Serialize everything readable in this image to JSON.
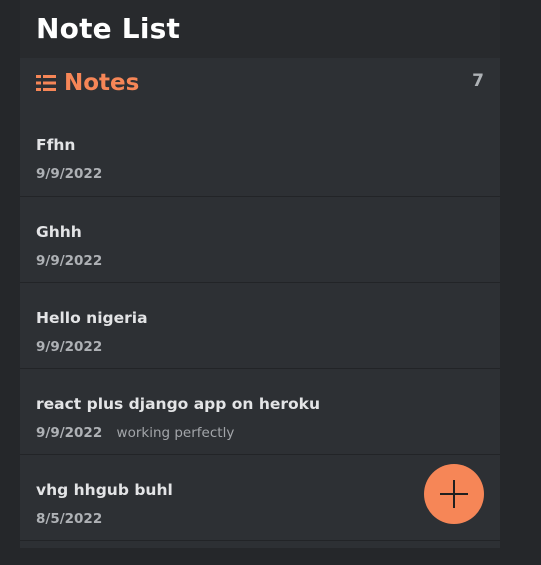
{
  "header": {
    "title": "Note List"
  },
  "notes_section": {
    "icon": "list-icon",
    "title": "Notes",
    "count": "7"
  },
  "notes": [
    {
      "title": "Ffhn",
      "date": "9/9/2022",
      "preview": ""
    },
    {
      "title": "Ghhh",
      "date": "9/9/2022",
      "preview": ""
    },
    {
      "title": "Hello nigeria",
      "date": "9/9/2022",
      "preview": ""
    },
    {
      "title": "react plus django app on heroku",
      "date": "9/9/2022",
      "preview": "working perfectly"
    },
    {
      "title": "vhg hhgub buhl",
      "date": "8/5/2022",
      "preview": ""
    }
  ],
  "fab": {
    "icon": "plus-icon"
  },
  "colors": {
    "accent": "#f68657",
    "background": "#2d3034",
    "header_background": "#282a2d",
    "text_primary": "#e3e4e6",
    "text_secondary": "#a9acb0"
  }
}
